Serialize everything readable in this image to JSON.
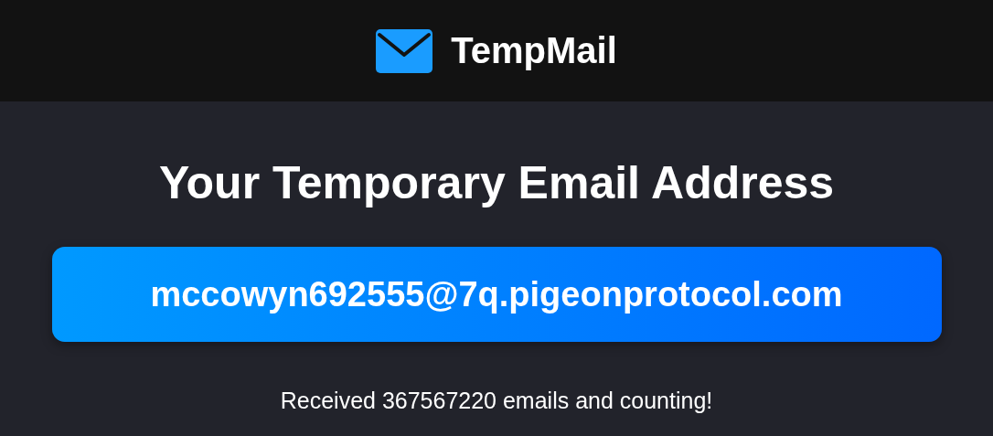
{
  "header": {
    "logo": "TempMail"
  },
  "title": "Your Temporary Email Address",
  "email": {
    "address": "mccowyn692555@7q.pigeonprotocol.com"
  },
  "counter": "Received 367567220 emails and counting!"
}
